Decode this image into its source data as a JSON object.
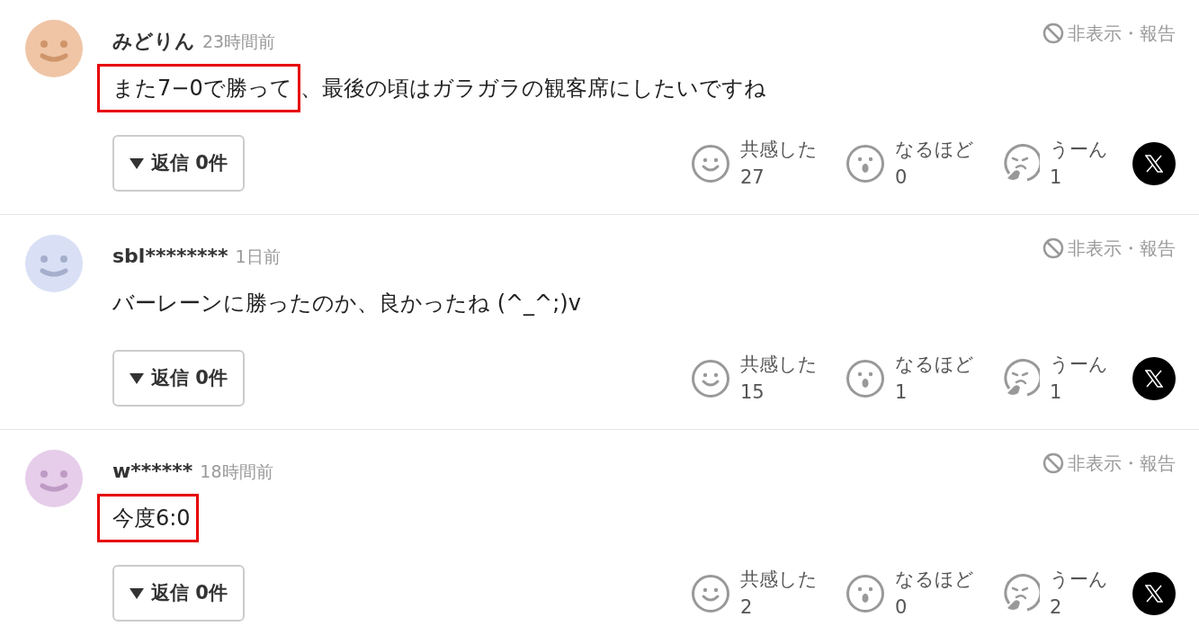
{
  "comments": [
    {
      "author": "みどりん",
      "time": "23時間前",
      "avatar": {
        "color": "#efc5a6"
      },
      "hide_report": "非表示・報告",
      "body": [
        {
          "text": "また7−0で勝って",
          "boxed": true
        },
        {
          "text": "、最後の頃はガラガラの観客席にしたいですね",
          "boxed": false
        }
      ],
      "replies": "返信 0件",
      "reactions": [
        {
          "kind": "smile",
          "label": "共感した",
          "count": "27"
        },
        {
          "kind": "surprised",
          "label": "なるほど",
          "count": "0"
        },
        {
          "kind": "thinking",
          "label": "うーん",
          "count": "1"
        }
      ]
    },
    {
      "author": "sbl********",
      "time": "1日前",
      "avatar": {
        "color": "#d9e0f5"
      },
      "hide_report": "非表示・報告",
      "body": [
        {
          "text": "バーレーンに勝ったのか、良かったね (^_^;)v",
          "boxed": false
        }
      ],
      "replies": "返信 0件",
      "reactions": [
        {
          "kind": "smile",
          "label": "共感した",
          "count": "15"
        },
        {
          "kind": "surprised",
          "label": "なるほど",
          "count": "1"
        },
        {
          "kind": "thinking",
          "label": "うーん",
          "count": "1"
        }
      ]
    },
    {
      "author": "w******",
      "time": "18時間前",
      "avatar": {
        "color": "#e6cdea"
      },
      "hide_report": "非表示・報告",
      "body": [
        {
          "text": "今度6:0",
          "boxed": true
        }
      ],
      "replies": "返信 0件",
      "reactions": [
        {
          "kind": "smile",
          "label": "共感した",
          "count": "2"
        },
        {
          "kind": "surprised",
          "label": "なるほど",
          "count": "0"
        },
        {
          "kind": "thinking",
          "label": "うーん",
          "count": "2"
        }
      ]
    }
  ]
}
